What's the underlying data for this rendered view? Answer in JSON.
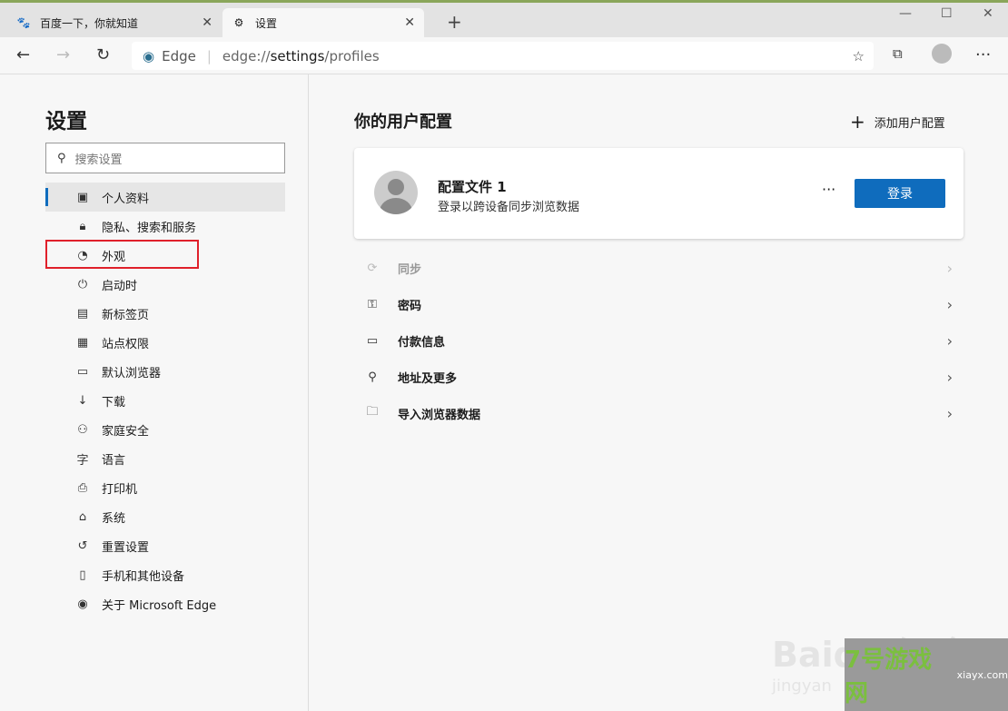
{
  "tabs": [
    {
      "label": "百度一下，你就知道",
      "icon": "baidu-paw-icon"
    },
    {
      "label": "设置",
      "icon": "gear-icon",
      "active": true
    }
  ],
  "address": {
    "brand": "Edge",
    "url_prefix": "edge://",
    "url_host": "settings",
    "url_path": "/profiles"
  },
  "sidebar": {
    "title": "设置",
    "search_placeholder": "搜索设置",
    "items": [
      {
        "label": "个人资料",
        "icon": "profile-icon",
        "active": true
      },
      {
        "label": "隐私、搜索和服务",
        "icon": "lock-icon"
      },
      {
        "label": "外观",
        "icon": "palette-icon",
        "highlighted": true
      },
      {
        "label": "启动时",
        "icon": "power-icon"
      },
      {
        "label": "新标签页",
        "icon": "new-tab-icon"
      },
      {
        "label": "站点权限",
        "icon": "site-permissions-icon"
      },
      {
        "label": "默认浏览器",
        "icon": "default-browser-icon"
      },
      {
        "label": "下载",
        "icon": "download-icon"
      },
      {
        "label": "家庭安全",
        "icon": "family-icon"
      },
      {
        "label": "语言",
        "icon": "language-icon"
      },
      {
        "label": "打印机",
        "icon": "printer-icon"
      },
      {
        "label": "系统",
        "icon": "system-icon"
      },
      {
        "label": "重置设置",
        "icon": "reset-icon"
      },
      {
        "label": "手机和其他设备",
        "icon": "phone-icon"
      },
      {
        "label": "关于 Microsoft Edge",
        "icon": "edge-icon"
      }
    ]
  },
  "main": {
    "title": "你的用户配置",
    "add_profile": "添加用户配置",
    "profile": {
      "name": "配置文件 1",
      "subtitle": "登录以跨设备同步浏览数据",
      "more": "···",
      "login": "登录"
    },
    "rows": [
      {
        "label": "同步",
        "icon": "sync-icon",
        "disabled": true
      },
      {
        "label": "密码",
        "icon": "key-icon"
      },
      {
        "label": "付款信息",
        "icon": "card-icon"
      },
      {
        "label": "地址及更多",
        "icon": "location-icon"
      },
      {
        "label": "导入浏览器数据",
        "icon": "import-icon"
      }
    ]
  },
  "watermarks": {
    "baidu": "Baidu 经验",
    "baidu_sub": "jingyan",
    "site": "7号游戏网",
    "site_sub": "xiayx.com"
  },
  "colors": {
    "accent": "#0f6cbd",
    "highlight": "#e0202a"
  }
}
